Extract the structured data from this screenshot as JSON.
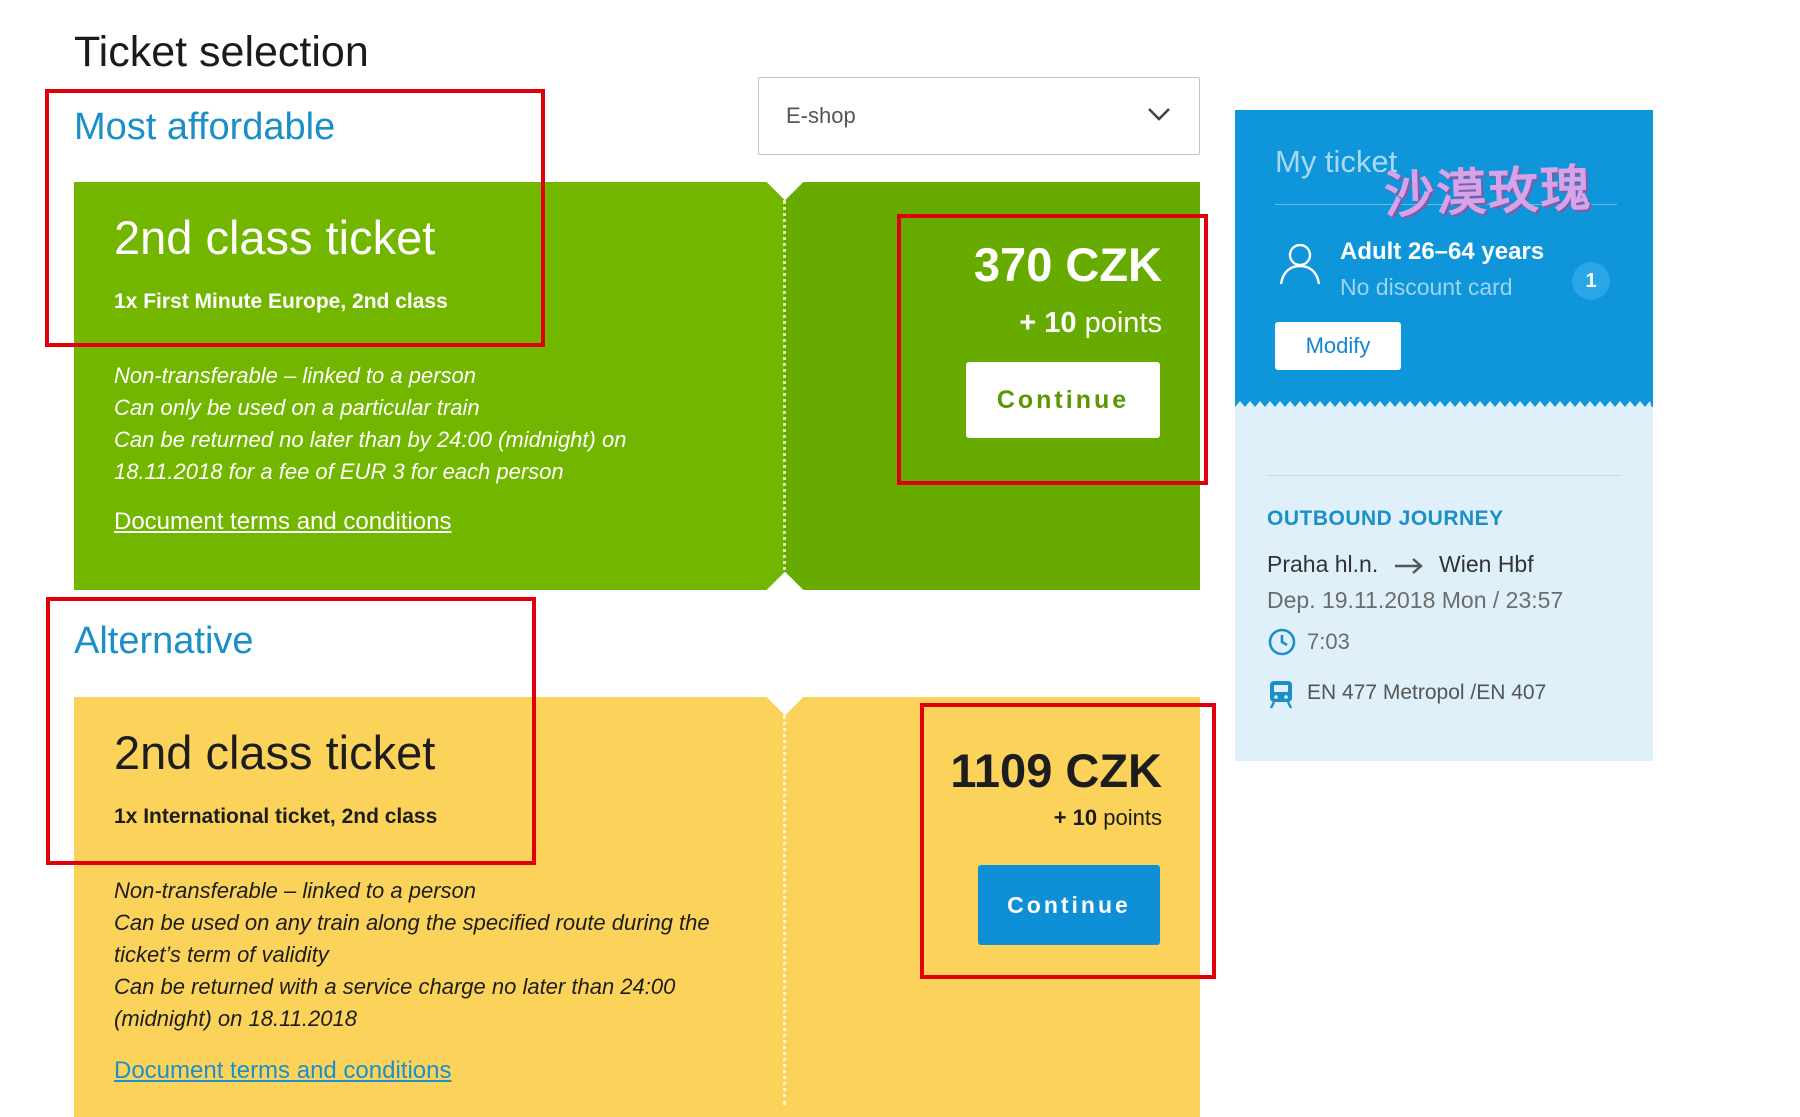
{
  "page": {
    "title": "Ticket selection"
  },
  "channel_select": {
    "value": "E-shop"
  },
  "sections": {
    "affordable": {
      "heading": "Most affordable",
      "ticket_title": "2nd class ticket",
      "ticket_sub": "1x First Minute Europe, 2nd class",
      "notes": [
        "Non-transferable – linked to a person",
        "Can only be used on a particular train",
        "Can be returned no later than by 24:00 (midnight) on",
        "18.11.2018 for a fee of EUR 3 for each person"
      ],
      "terms_link": "Document terms and conditions",
      "price": "370 CZK",
      "points_value": "+ 10",
      "points_label": "points",
      "continue_label": "Continue"
    },
    "alternative": {
      "heading": "Alternative",
      "ticket_title": "2nd class ticket",
      "ticket_sub": "1x International ticket, 2nd class",
      "notes": [
        "Non-transferable – linked to a person",
        "Can be used on any train along the specified route during the",
        "ticket’s term of validity",
        "Can be returned with a service charge no later than 24:00",
        "(midnight) on 18.11.2018"
      ],
      "terms_link": "Document terms and conditions",
      "price": "1109 CZK",
      "points_value": "+ 10",
      "points_label": "points",
      "continue_label": "Continue"
    }
  },
  "my_ticket": {
    "title": "My ticket",
    "passenger_type": "Adult 26–64 years",
    "discount_card": "No discount card",
    "passenger_count": "1",
    "modify_label": "Modify",
    "journey_heading": "OUTBOUND JOURNEY",
    "from": "Praha hl.n.",
    "to": "Wien Hbf",
    "departure": "Dep. 19.11.2018 Mon / 23:57",
    "duration": "7:03",
    "train": "EN 477 Metropol /EN 407"
  },
  "watermark": "沙漠玫瑰",
  "colors": {
    "green": "#73b600",
    "green_dark": "#68ab00",
    "yellow": "#fbd35a",
    "accent_blue": "#0e95da",
    "highlight_red": "#e0000b"
  },
  "icons": [
    "chevron-down-icon",
    "person-icon",
    "arrow-right-icon",
    "clock-icon",
    "train-icon"
  ]
}
